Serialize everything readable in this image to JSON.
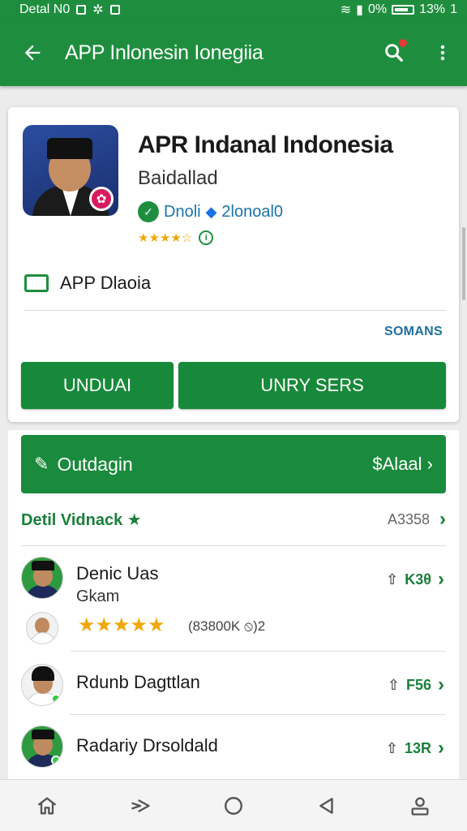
{
  "status": {
    "left_text": "Detal N0",
    "battery_pct": "0%",
    "right_text": "13%",
    "signal_label": "1"
  },
  "appbar": {
    "title": "APP Inlonesin Ionegiia"
  },
  "app": {
    "title": "APR Indanal Indonesia",
    "developer": "Baidallad",
    "dev_name": "Dnoli",
    "dev_tag": "2lonoal0",
    "category": "APP Dlaoia",
    "link": "SOMANS",
    "rating_stars": "★★★★☆"
  },
  "buttons": {
    "primary": "UNDUAI",
    "secondary": "UNRY SERS"
  },
  "banner": {
    "label": "Outdagin",
    "right": "$Alaal"
  },
  "section": {
    "title": "Detil Vidnack ★",
    "count": "A3358"
  },
  "list": [
    {
      "title": "Denic Uas",
      "sub": "Gkam",
      "right": "K3θ",
      "stars": "★★★★★",
      "meta": "(83800K ⦸)2"
    },
    {
      "title": "Rdunb Dagttlan",
      "right": "F56"
    },
    {
      "title": "Radariy Drsoldald",
      "right": "13R"
    }
  ],
  "icons": {
    "back": "arrow-left-icon",
    "search": "search-icon",
    "more": "more-vert-icon",
    "home": "home-icon",
    "forward": "forward-icon",
    "circle": "circle-icon",
    "triangle": "back-triangle-icon",
    "profile": "profile-icon"
  },
  "colors": {
    "primary": "#1e8e3e",
    "button": "#17893a",
    "star": "#f0a70a",
    "link": "#1f6f9f"
  }
}
